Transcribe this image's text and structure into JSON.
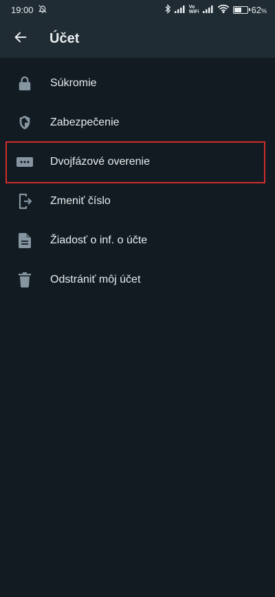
{
  "status_bar": {
    "time": "19:00",
    "vowifi_top": "Vo",
    "vowifi_bottom": "WiFi",
    "battery_percent": "62",
    "battery_percent_suffix": "%",
    "battery_level": 0.62
  },
  "app_bar": {
    "title": "Účet"
  },
  "menu": {
    "items": [
      {
        "label": "Súkromie",
        "icon": "lock-icon"
      },
      {
        "label": "Zabezpečenie",
        "icon": "shield-icon"
      },
      {
        "label": "Dvojfázové overenie",
        "icon": "dots-icon"
      },
      {
        "label": "Zmeniť číslo",
        "icon": "change-number-icon"
      },
      {
        "label": "Žiadosť o inf. o účte",
        "icon": "document-icon"
      },
      {
        "label": "Odstrániť môj účet",
        "icon": "trash-icon"
      }
    ]
  },
  "colors": {
    "background": "#121b22",
    "app_bar": "#1f2c34",
    "icon": "#8696a0",
    "text": "#e9edef",
    "highlight_border": "#d32b2b"
  }
}
